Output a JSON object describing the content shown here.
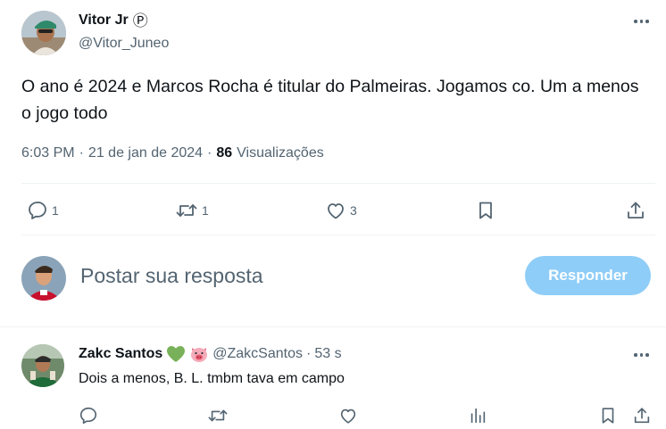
{
  "tweet": {
    "author_name": "Vitor Jr",
    "badge_glyph": "Ⓟ",
    "handle": "@Vitor_Juneo",
    "text": "O ano é 2024 e Marcos Rocha é titular do Palmeiras. Jogamos co. Um a menos o jogo todo",
    "time": "6:03 PM",
    "separator": "·",
    "date": "21 de jan de 2024",
    "views_count": "86",
    "views_label": "Visualizações",
    "replies": "1",
    "reposts": "1",
    "likes": "3"
  },
  "composer": {
    "placeholder": "Postar sua resposta",
    "button_label": "Responder"
  },
  "reply": {
    "author_name": "Zakc Santos",
    "emojis": [
      "green-heart",
      "pig-face"
    ],
    "handle": "@ZakcSantos",
    "separator": "·",
    "time": "53 s",
    "text": "Dois a menos, B. L. tmbm tava em campo"
  },
  "colors": {
    "text": "#0f1419",
    "muted": "#536471",
    "divider": "#eff3f4",
    "button_disabled": "#8ecdf8",
    "green_heart": "#78b159",
    "pig_pink": "#f4abba"
  },
  "icons": [
    "more-icon",
    "reply-icon",
    "repost-icon",
    "like-icon",
    "bookmark-icon",
    "share-icon",
    "views-icon",
    "verified-badge-icon"
  ]
}
